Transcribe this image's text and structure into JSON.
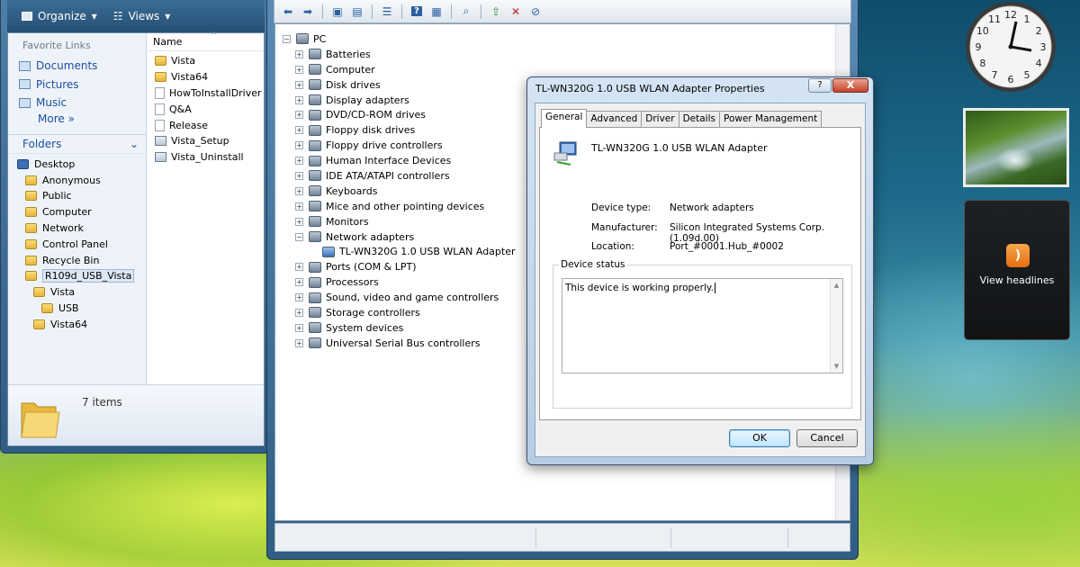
{
  "explorer": {
    "toolbar": {
      "organize": "Organize",
      "views": "Views"
    },
    "favorites_heading": "Favorite Links",
    "favorites": [
      "Documents",
      "Pictures",
      "Music"
    ],
    "more": "More",
    "folders_heading": "Folders",
    "tree": [
      {
        "label": "Desktop",
        "indent": 0
      },
      {
        "label": "Anonymous",
        "indent": 1
      },
      {
        "label": "Public",
        "indent": 1
      },
      {
        "label": "Computer",
        "indent": 1
      },
      {
        "label": "Network",
        "indent": 1
      },
      {
        "label": "Control Panel",
        "indent": 1
      },
      {
        "label": "Recycle Bin",
        "indent": 1
      },
      {
        "label": "R109d_USB_Vista",
        "indent": 1,
        "selected": true
      },
      {
        "label": "Vista",
        "indent": 2
      },
      {
        "label": "USB",
        "indent": 3
      },
      {
        "label": "Vista64",
        "indent": 2
      }
    ],
    "column_name": "Name",
    "files": [
      {
        "name": "Vista",
        "kind": "folder"
      },
      {
        "name": "Vista64",
        "kind": "folder"
      },
      {
        "name": "HowToInstallDriver",
        "kind": "doc"
      },
      {
        "name": "Q&A",
        "kind": "doc"
      },
      {
        "name": "Release",
        "kind": "doc"
      },
      {
        "name": "Vista_Setup",
        "kind": "app"
      },
      {
        "name": "Vista_Uninstall",
        "kind": "app"
      }
    ],
    "items_count": "7 items"
  },
  "device_manager": {
    "root": "PC",
    "categories": [
      {
        "label": "Batteries",
        "expanded": false
      },
      {
        "label": "Computer",
        "expanded": false
      },
      {
        "label": "Disk drives",
        "expanded": false
      },
      {
        "label": "Display adapters",
        "expanded": false
      },
      {
        "label": "DVD/CD-ROM drives",
        "expanded": false
      },
      {
        "label": "Floppy disk drives",
        "expanded": false
      },
      {
        "label": "Floppy drive controllers",
        "expanded": false
      },
      {
        "label": "Human Interface Devices",
        "expanded": false
      },
      {
        "label": "IDE ATA/ATAPI controllers",
        "expanded": false
      },
      {
        "label": "Keyboards",
        "expanded": false
      },
      {
        "label": "Mice and other pointing devices",
        "expanded": false
      },
      {
        "label": "Monitors",
        "expanded": false
      },
      {
        "label": "Network adapters",
        "expanded": true,
        "children": [
          "TL-WN320G 1.0 USB WLAN Adapter"
        ]
      },
      {
        "label": "Ports (COM & LPT)",
        "expanded": false
      },
      {
        "label": "Processors",
        "expanded": false
      },
      {
        "label": "Sound, video and game controllers",
        "expanded": false
      },
      {
        "label": "Storage controllers",
        "expanded": false
      },
      {
        "label": "System devices",
        "expanded": false
      },
      {
        "label": "Universal Serial Bus controllers",
        "expanded": false
      }
    ]
  },
  "dialog": {
    "title": "TL-WN320G 1.0 USB WLAN Adapter Properties",
    "help_label": "?",
    "close_label": "X",
    "tabs": [
      "General",
      "Advanced",
      "Driver",
      "Details",
      "Power Management"
    ],
    "active_tab": "General",
    "device_name": "TL-WN320G 1.0 USB WLAN Adapter",
    "labels": {
      "device_type": "Device type:",
      "manufacturer": "Manufacturer:",
      "location": "Location:"
    },
    "values": {
      "device_type": "Network adapters",
      "manufacturer": "Silicon Integrated Systems Corp.(1.09d.00)",
      "location": "Port_#0001.Hub_#0002"
    },
    "status_heading": "Device status",
    "status_text": "This device is working properly.",
    "ok_label": "OK",
    "cancel_label": "Cancel"
  },
  "gadgets": {
    "clock_numbers": [
      "12",
      "1",
      "2",
      "3",
      "4",
      "5",
      "6",
      "7",
      "8",
      "9",
      "10",
      "11"
    ],
    "feed_label": "View headlines"
  }
}
